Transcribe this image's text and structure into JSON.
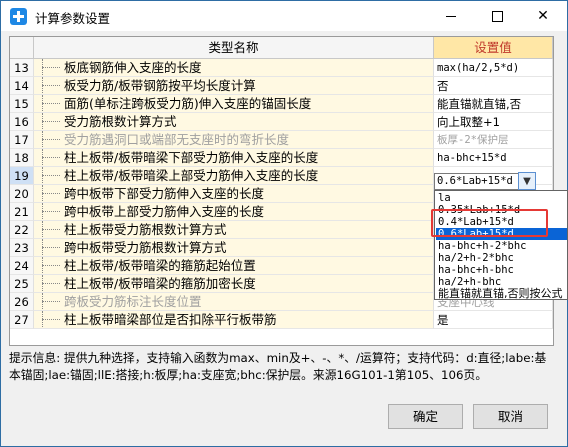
{
  "window": {
    "title": "计算参数设置",
    "close_glyph": "✕"
  },
  "grid": {
    "header_name": "类型名称",
    "header_value": "设置值",
    "rows": [
      {
        "num": "13",
        "name": "板底钢筋伸入支座的长度",
        "value": "max(ha/2,5*d)",
        "gray": false
      },
      {
        "num": "14",
        "name": "板受力筋/板带钢筋按平均长度计算",
        "value": "否",
        "gray": false
      },
      {
        "num": "15",
        "name": "面筋(单标注跨板受力筋)伸入支座的锚固长度",
        "value": "能直锚就直锚,否",
        "gray": false
      },
      {
        "num": "16",
        "name": "受力筋根数计算方式",
        "value": "向上取整+1",
        "gray": false
      },
      {
        "num": "17",
        "name": "受力筋遇洞口或端部无支座时的弯折长度",
        "value": "板厚-2*保护层",
        "gray": true
      },
      {
        "num": "18",
        "name": "柱上板带/板带暗梁下部受力筋伸入支座的长度",
        "value": "ha-bhc+15*d",
        "gray": false
      },
      {
        "num": "19",
        "name": "柱上板带/板带暗梁上部受力筋伸入支座的长度",
        "value": "",
        "gray": false
      },
      {
        "num": "20",
        "name": "跨中板带下部受力筋伸入支座的长度",
        "value": "",
        "gray": false
      },
      {
        "num": "21",
        "name": "跨中板带上部受力筋伸入支座的长度",
        "value": "",
        "gray": false
      },
      {
        "num": "22",
        "name": "柱上板带受力筋根数计算方式",
        "value": "",
        "gray": false
      },
      {
        "num": "23",
        "name": "跨中板带受力筋根数计算方式",
        "value": "",
        "gray": false
      },
      {
        "num": "24",
        "name": "柱上板带/板带暗梁的箍筋起始位置",
        "value": "",
        "gray": false
      },
      {
        "num": "25",
        "name": "柱上板带/板带暗梁的箍筋加密长度",
        "value": "",
        "gray": false
      },
      {
        "num": "26",
        "name": "跨板受力筋标注长度位置",
        "value": "支座中心线",
        "gray": true
      },
      {
        "num": "27",
        "name": "柱上板带暗梁部位是否扣除平行板带筋",
        "value": "是",
        "gray": false
      }
    ]
  },
  "combo": {
    "selected": "0.6*Lab+15*d"
  },
  "dropdown": {
    "options": [
      "la",
      "0.35*Lab+15*d",
      "0.4*Lab+15*d",
      "0.6*Lab+15*d",
      "ha-bhc+h-2*bhc",
      "ha/2+h-2*bhc",
      "ha-bhc+h-bhc",
      "ha/2+h-bhc",
      "能直锚就直锚,否则按公式"
    ],
    "highlighted_index": 3
  },
  "hint_text": "提示信息: 提供九种选择，支持输入函数为max、min及+、-、*、/运算符；支持代码：d:直径;labe:基本锚固;lae:锚固;llE:搭接;h:板厚;ha:支座宽;bhc:保护层。来源16G101-1第105、106页。",
  "buttons": {
    "ok": "确定",
    "cancel": "取消"
  },
  "colors": {
    "header_value_bg": "#ffe7a6",
    "header_value_text": "#c0392b",
    "highlight": "#0a64d6",
    "annotation_box": "#e53935"
  }
}
